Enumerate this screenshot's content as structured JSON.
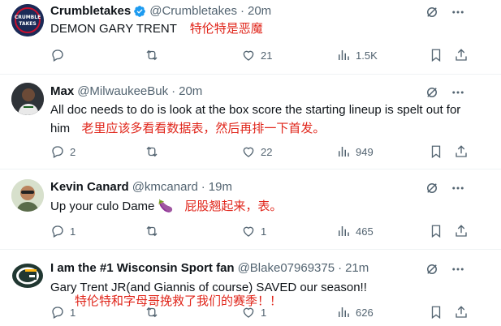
{
  "tweets": [
    {
      "name": "Crumbletakes",
      "verified": true,
      "handle": "@Crumbletakes",
      "time": "20m",
      "text": "DEMON GARY TRENT",
      "translation": "特伦特是恶魔",
      "avatar_text": "CRUMBLE TAKES",
      "replies": "",
      "reposts": "",
      "likes": "21",
      "views": "1.5K"
    },
    {
      "name": "Max",
      "verified": false,
      "handle": "@MilwaukeeBuk",
      "time": "20m",
      "text": "All doc needs to do is look at the box score the starting lineup is spelt out for him",
      "translation": "老里应该多看看数据表，然后再排一下首发。",
      "replies": "2",
      "reposts": "",
      "likes": "22",
      "views": "949"
    },
    {
      "name": "Kevin Canard",
      "verified": false,
      "handle": "@kmcanard",
      "time": "19m",
      "text": "Up your culo Dame 🍆",
      "translation": "屁股翘起来，表。",
      "replies": "1",
      "reposts": "",
      "likes": "1",
      "views": "465"
    },
    {
      "name": "I am the #1 Wisconsin Sport fan",
      "verified": false,
      "handle": "@Blake07969375",
      "time": "21m",
      "text": "Gary Trent JR(and Giannis of course) SAVED our season!!",
      "translation": "特伦特和字母哥挽救了我们的赛季！！",
      "replies": "1",
      "reposts": "",
      "likes": "1",
      "views": "626"
    }
  ],
  "sep": "·",
  "colors": {
    "accent": "#1d9bf0",
    "muted": "#536471",
    "annotation": "#e0261b"
  }
}
